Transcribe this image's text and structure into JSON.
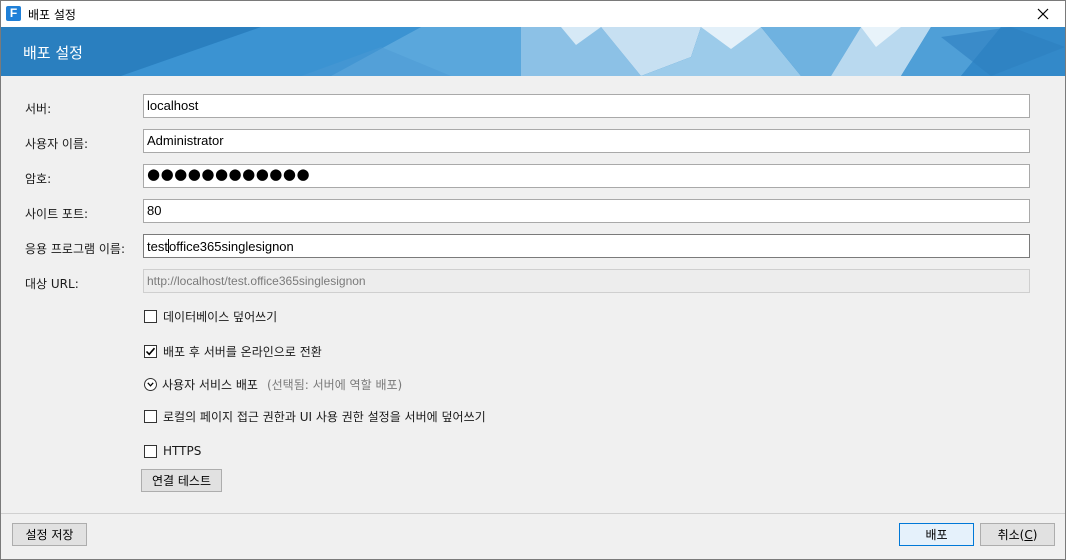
{
  "window": {
    "title": "배포 설정",
    "app_icon_letter": "F"
  },
  "banner": {
    "title": "배포 설정"
  },
  "form": {
    "server": {
      "label": "서버:",
      "value": "localhost"
    },
    "username": {
      "label": "사용자 이름:",
      "value": "Administrator"
    },
    "password": {
      "label": "암호:",
      "masked_value": "●●●●●●●●●●●●"
    },
    "site_port": {
      "label": "사이트 포트:",
      "value": "80"
    },
    "app_name": {
      "label": "응용 프로그램 이름:",
      "value_before_caret": "test",
      "value_after_caret": "office365singlesignon"
    },
    "target_url": {
      "label": "대상 URL:",
      "value": "http://localhost/test.office365singlesignon"
    }
  },
  "options": {
    "overwrite_db": {
      "label": "데이터베이스 덮어쓰기",
      "checked": false
    },
    "online_after_deploy": {
      "label": "배포 후 서버를 온라인으로 전환",
      "checked": true
    },
    "user_services": {
      "label": "사용자 서비스 배포",
      "hint": "(선택됨: 서버에 역할 배포)"
    },
    "overwrite_permissions": {
      "label": "로컬의 페이지 접근 권한과 UI 사용 권한 설정을 서버에 덮어쓰기",
      "checked": false
    },
    "https": {
      "label": "HTTPS",
      "checked": false
    }
  },
  "buttons": {
    "test_connection": "연결 테스트",
    "save_settings": "설정 저장",
    "deploy": "배포",
    "cancel_prefix": "취소(",
    "cancel_mnemonic": "C",
    "cancel_suffix": ")"
  },
  "colors": {
    "banner_blue": "#2b86c9",
    "app_icon_blue": "#1f80d8",
    "primary_border": "#0078d7"
  },
  "icons": {
    "close": "close-icon",
    "check": "checkmark-icon",
    "expander": "chevron-down-circle-icon"
  }
}
